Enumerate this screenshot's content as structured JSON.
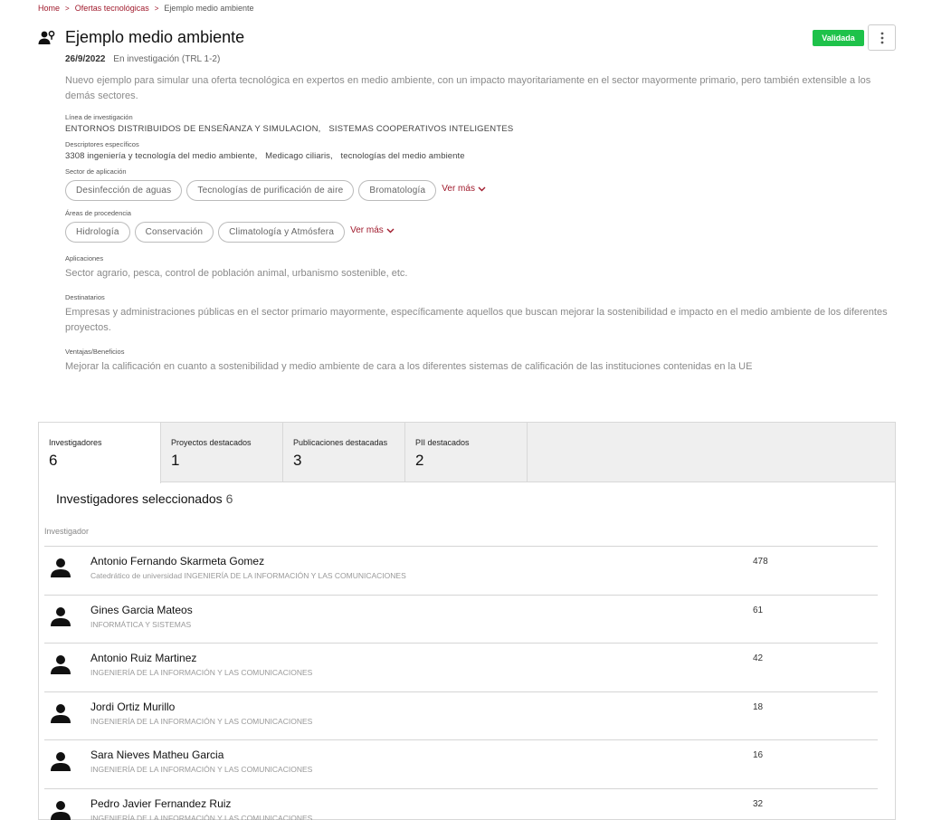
{
  "breadcrumb": {
    "home": "Home",
    "ofertas": "Ofertas tecnológicas",
    "current": "Ejemplo medio ambiente"
  },
  "header": {
    "title": "Ejemplo medio ambiente",
    "status_badge": "Validada",
    "date": "26/9/2022",
    "stage": "En investigación (TRL 1-2)"
  },
  "description": "Nuevo ejemplo para simular una oferta tecnológica en expertos en medio ambiente, con un impacto mayoritariamente en el sector mayormente primario, pero también extensible a los demás sectores.",
  "linea": {
    "label": "Línea de investigación",
    "values": [
      "ENTORNOS DISTRIBUIDOS DE ENSEÑANZA Y SIMULACION,",
      "SISTEMAS COOPERATIVOS INTELIGENTES"
    ]
  },
  "descriptores": {
    "label": "Descriptores específicos",
    "values": [
      "3308 ingeniería y tecnología del medio ambiente,",
      "Medicago ciliaris,",
      "tecnologías del medio ambiente"
    ]
  },
  "sector": {
    "label": "Sector de aplicación",
    "chips": [
      "Desinfección de aguas",
      "Tecnologías de purificación de aire",
      "Bromatología"
    ],
    "ver_mas": "Ver más"
  },
  "areas": {
    "label": "Áreas de procedencia",
    "chips": [
      "Hidrología",
      "Conservación",
      "Climatología y Atmósfera"
    ],
    "ver_mas": "Ver más"
  },
  "aplicaciones": {
    "label": "Aplicaciones",
    "text": "Sector agrario, pesca, control de población animal, urbanismo sostenible, etc."
  },
  "destinatarios": {
    "label": "Destinatarios",
    "text": "Empresas y administraciones públicas en el sector primario mayormente, específicamente aquellos que buscan mejorar la sostenibilidad e impacto en el medio ambiente de los diferentes proyectos."
  },
  "ventajas": {
    "label": "Ventajas/Beneficios",
    "text": "Mejorar la calificación en cuanto a sostenibilidad y medio ambiente de cara a los diferentes sistemas de calificación de las instituciones contenidas en la UE"
  },
  "tabs": [
    {
      "label": "Investigadores",
      "count": "6"
    },
    {
      "label": "Proyectos destacados",
      "count": "1"
    },
    {
      "label": "Publicaciones destacadas",
      "count": "3"
    },
    {
      "label": "PII destacados",
      "count": "2"
    }
  ],
  "researchers": {
    "title": "Investigadores seleccionados",
    "count": "6",
    "column_header": "Investigador",
    "rows": [
      {
        "name": "Antonio Fernando Skarmeta Gomez",
        "sub": "Catedrático de universidad INGENIERÍA DE LA INFORMACIÓN Y LAS COMUNICACIONES",
        "value": "478"
      },
      {
        "name": "Gines Garcia Mateos",
        "sub": "INFORMÁTICA Y SISTEMAS",
        "value": "61"
      },
      {
        "name": "Antonio Ruiz Martinez",
        "sub": "INGENIERÍA DE LA INFORMACIÓN Y LAS COMUNICACIONES",
        "value": "42"
      },
      {
        "name": "Jordi Ortiz Murillo",
        "sub": "INGENIERÍA DE LA INFORMACIÓN Y LAS COMUNICACIONES",
        "value": "18"
      },
      {
        "name": "Sara Nieves Matheu Garcia",
        "sub": "INGENIERÍA DE LA INFORMACIÓN Y LAS COMUNICACIONES",
        "value": "16"
      },
      {
        "name": "Pedro Javier Fernandez Ruiz",
        "sub": "INGENIERÍA DE LA INFORMACIÓN Y LAS COMUNICACIONES",
        "value": "32"
      }
    ]
  },
  "colors": {
    "accent": "#a01a2c",
    "badge_green": "#1ec24a"
  }
}
